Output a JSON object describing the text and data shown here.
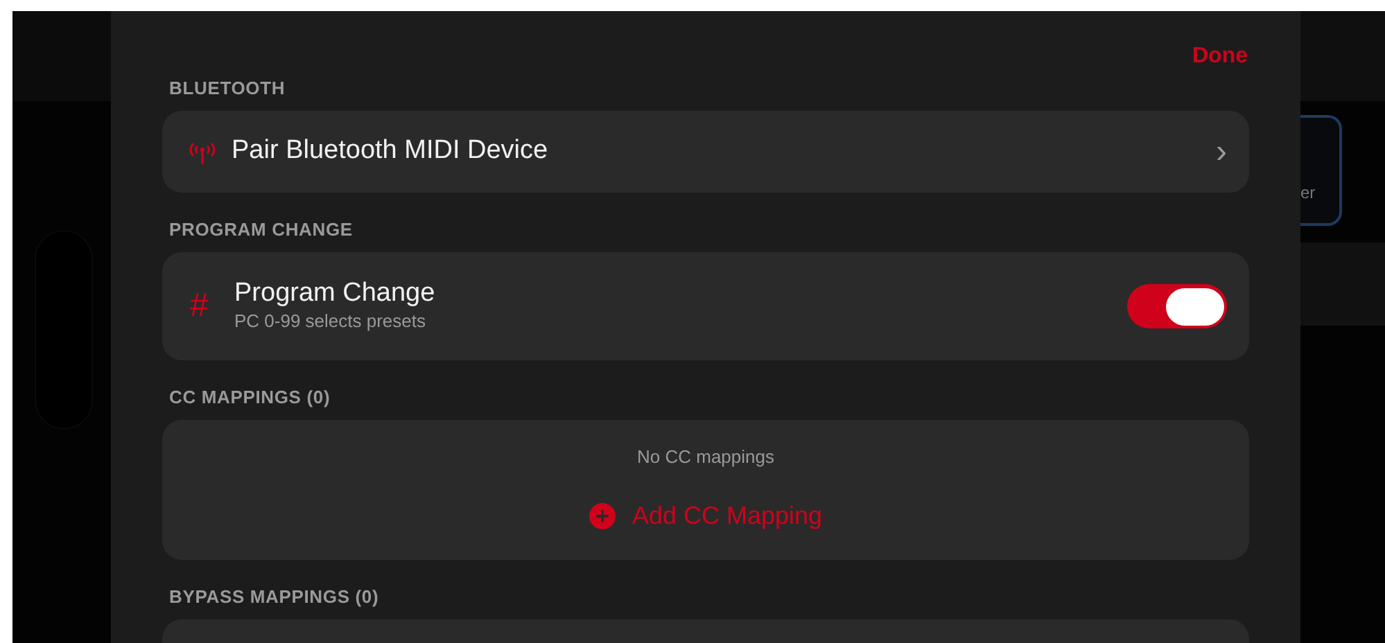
{
  "background": {
    "card_text": "er"
  },
  "sheet": {
    "done_button": "Done",
    "sections": [
      {
        "kind": "link",
        "header": "BLUETOOTH",
        "label": "Pair Bluetooth MIDI Device",
        "chevron": "›"
      },
      {
        "kind": "toggle",
        "header": "PROGRAM CHANGE",
        "icon_char": "#",
        "title": "Program Change",
        "subtitle": "PC 0-99 selects presets",
        "on": true
      },
      {
        "kind": "empty",
        "header": "CC MAPPINGS (0)",
        "message": "No CC mappings",
        "action": "Add CC Mapping"
      },
      {
        "kind": "cut",
        "header": "BYPASS MAPPINGS (0)"
      }
    ]
  }
}
